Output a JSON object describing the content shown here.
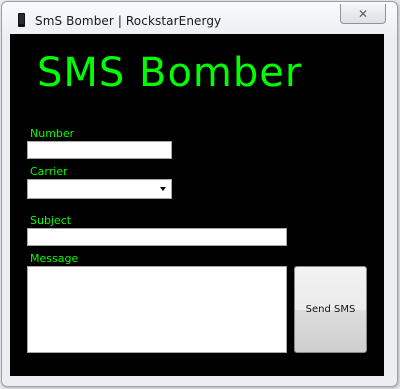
{
  "window": {
    "title": "SmS Bomber | RockstarEnergy",
    "close_glyph": "✕"
  },
  "form": {
    "heading": "SMS Bomber",
    "number_label": "Number",
    "number_value": "",
    "carrier_label": "Carrier",
    "carrier_value": "",
    "subject_label": "Subject",
    "subject_value": "",
    "message_label": "Message",
    "message_value": "",
    "send_label": "Send SMS"
  },
  "colors": {
    "background": "#000000",
    "accent": "#00ff00"
  },
  "icons": {
    "app": "app-icon",
    "close": "close-icon",
    "dropdown": "chevron-down-icon"
  }
}
